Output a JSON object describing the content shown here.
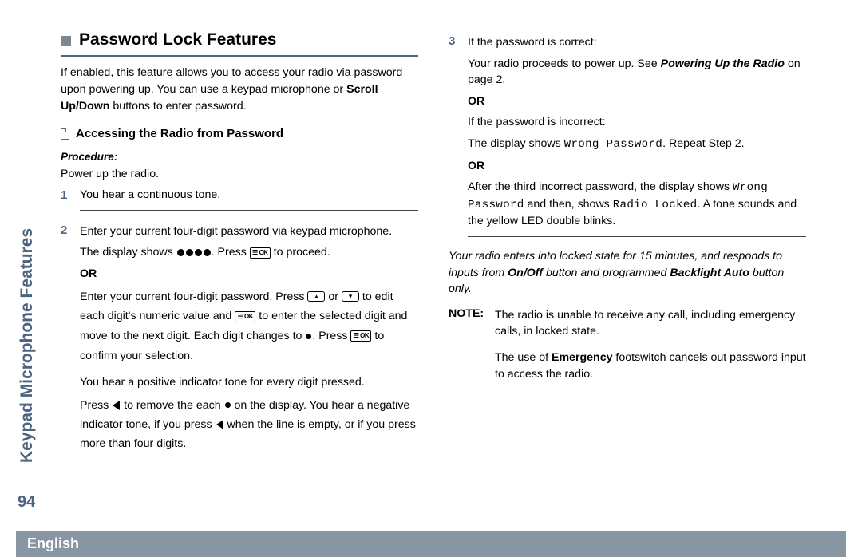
{
  "side_title": "Keypad Microphone Features",
  "page_number": "94",
  "language": "English",
  "section": {
    "title": "Password Lock Features",
    "intro_prefix": "If enabled, this feature allows you to access your radio via password upon powering up. You can use a keypad microphone or ",
    "intro_bold": "Scroll Up/Down",
    "intro_suffix": " buttons to enter password."
  },
  "subsection": {
    "title": "Accessing the Radio from Password",
    "procedure_label": "Procedure:",
    "intro": "Power up the radio."
  },
  "steps": {
    "s1": {
      "num": "1",
      "text": "You hear a continuous tone."
    },
    "s2": {
      "num": "2",
      "p1": "Enter your current four-digit password via keypad microphone.",
      "p2a": "The display shows ",
      "p2b": ". Press ",
      "p2c": " to proceed.",
      "or": "OR",
      "p3a": "Enter your current four-digit password. Press ",
      "p3_or": " or ",
      "p3b": " to edit each digit's numeric value and ",
      "p3c": " to enter the selected digit and move to the next digit. Each digit changes to ",
      "p3d": ". Press ",
      "p3e": " to confirm your selection.",
      "p4": "You hear a positive indicator tone for every digit pressed.",
      "p5a": "Press ",
      "p5b": " to remove the each ",
      "p5c": " on the display. You hear a negative indicator tone, if you press ",
      "p5d": " when the line is empty, or if you press more than four digits."
    },
    "s3": {
      "num": "3",
      "p1": "If the password is correct:",
      "p2a": "Your radio proceeds to power up. See ",
      "p2b_bolditalic": "Powering Up the Radio",
      "p2c": " on page 2.",
      "or1": "OR",
      "p3": "If the password is incorrect:",
      "p4a": "The display shows ",
      "p4_mono": "Wrong Password",
      "p4b": ". Repeat Step 2.",
      "or2": "OR",
      "p5a": "After the third incorrect password, the display shows ",
      "p5_mono1": "Wrong Password",
      "p5b": " and then, shows ",
      "p5_mono2": "Radio Locked",
      "p5c": ". A tone sounds and the yellow LED double blinks."
    }
  },
  "locked_note": {
    "a": "Your radio enters into locked state for 15 minutes, and responds to inputs from ",
    "b_bold": "On/Off",
    "c": " button and programmed ",
    "d_bold": "Backlight  Auto",
    "e": " button only."
  },
  "note": {
    "label": "NOTE:",
    "p1": "The radio is unable to receive any call, including emergency calls, in locked state.",
    "p2a": "The use of ",
    "p2b_bold": "Emergency",
    "p2c": " footswitch cancels out password input to access the radio."
  },
  "keys": {
    "ok": "☰ OK",
    "up": "▴",
    "down": "▾"
  }
}
